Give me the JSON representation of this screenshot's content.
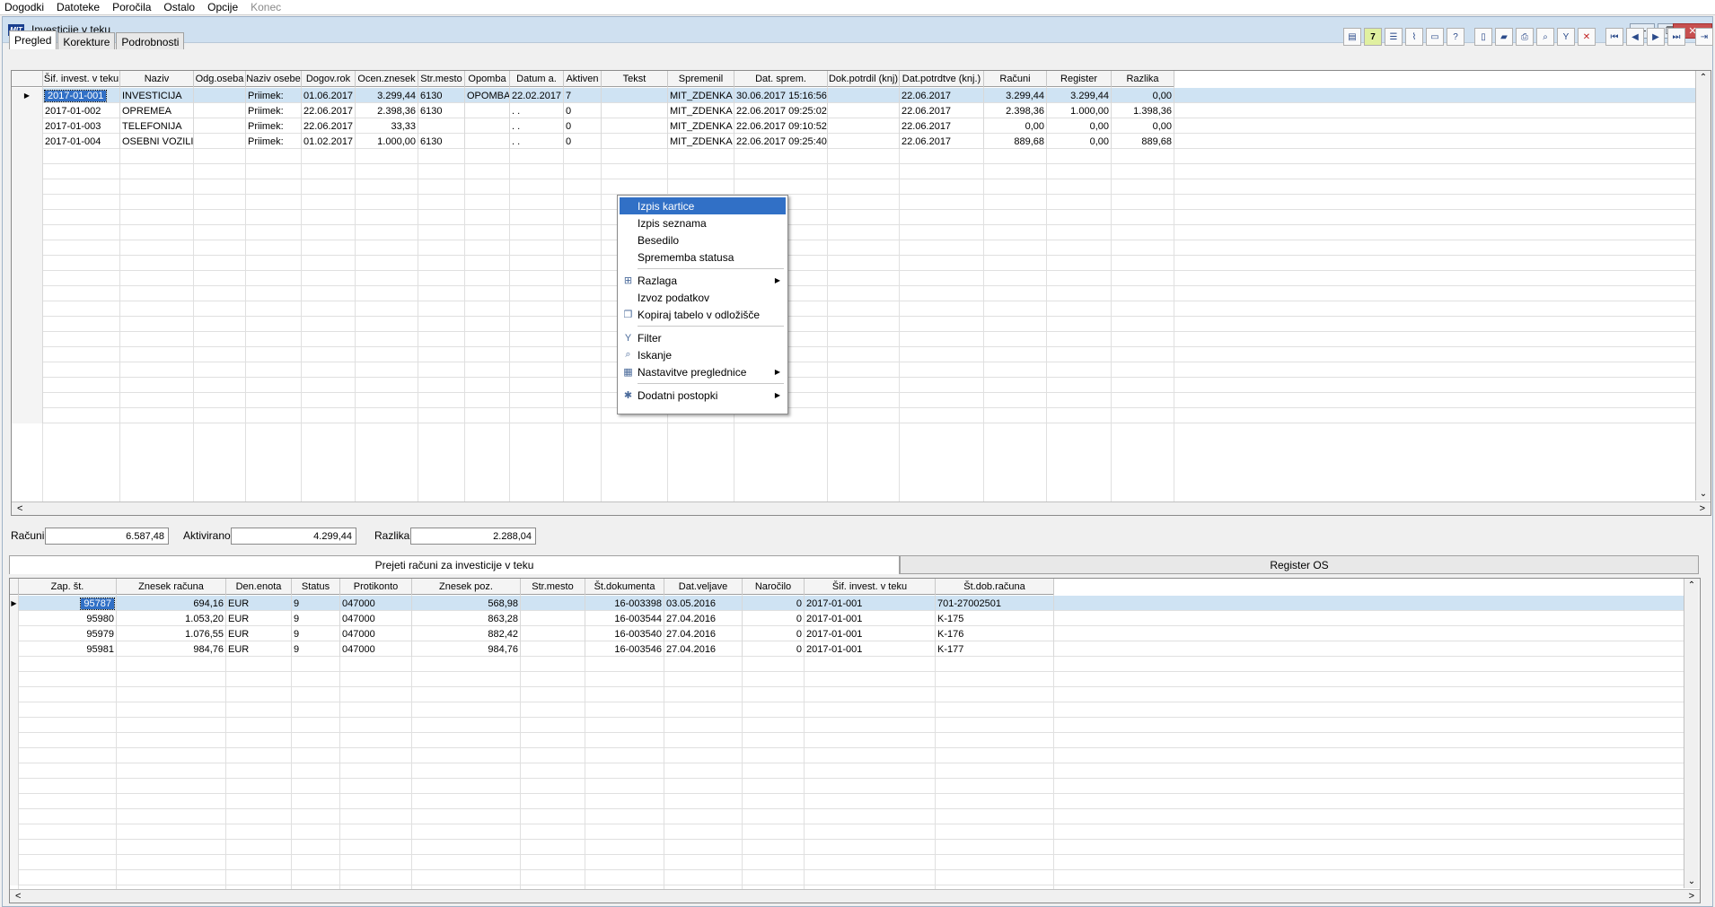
{
  "menubar": [
    "Dogodki",
    "Datoteke",
    "Poročila",
    "Ostalo",
    "Opcije",
    "Konec"
  ],
  "window": {
    "title": "Investicije v teku"
  },
  "tabs": [
    "Pregled",
    "Korekture",
    "Podrobnosti"
  ],
  "toolbar_icons": [
    "form-icon",
    "calendar-7-icon",
    "list-icon",
    "paperclip-icon",
    "monitor-icon",
    "help-icon",
    "new-document-icon",
    "open-folder-icon",
    "print-icon",
    "search-icon",
    "filter-icon",
    "delete-icon",
    "first-record-icon",
    "previous-record-icon",
    "next-record-icon",
    "last-record-icon",
    "exit-icon"
  ],
  "main_grid": {
    "columns": [
      "Šif. invest. v teku",
      "Naziv",
      "Odg.oseba",
      "Naziv osebe",
      "Dogov.rok",
      "Ocen.znesek",
      "Str.mesto",
      "Opomba",
      "Datum a.",
      "Aktiven",
      "Tekst",
      "Spremenil",
      "Dat. sprem.",
      "Dok.potrdil (knj)",
      "Dat.potrdtve (knj.)",
      "Računi",
      "Register",
      "Razlika"
    ],
    "rows": [
      [
        "2017-01-001",
        "INVESTICIJA",
        "",
        "Priimek:",
        "01.06.2017",
        "3.299,44",
        "6130",
        "OPOMBA",
        "22.02.2017",
        "7",
        "",
        "MIT_ZDENKA",
        "30.06.2017 15:16:56",
        "",
        "22.06.2017",
        "3.299,44",
        "3.299,44",
        "0,00"
      ],
      [
        "2017-01-002",
        "OPREMEA",
        "",
        "Priimek:",
        "22.06.2017",
        "2.398,36",
        "6130",
        "",
        ". .",
        "0",
        "",
        "MIT_ZDENKA",
        "22.06.2017 09:25:02",
        "",
        "22.06.2017",
        "2.398,36",
        "1.000,00",
        "1.398,36"
      ],
      [
        "2017-01-003",
        "TELEFONIJA",
        "",
        "Priimek:",
        "22.06.2017",
        "33,33",
        "",
        "",
        ". .",
        "0",
        "",
        "MIT_ZDENKA",
        "22.06.2017 09:10:52",
        "",
        "22.06.2017",
        "0,00",
        "0,00",
        "0,00"
      ],
      [
        "2017-01-004",
        "OSEBNI VOZILI",
        "",
        "Priimek:",
        "01.02.2017",
        "1.000,00",
        "6130",
        "",
        ". .",
        "0",
        "",
        "MIT_ZDENKA",
        "22.06.2017 09:25:40",
        "",
        "22.06.2017",
        "889,68",
        "0,00",
        "889,68"
      ]
    ]
  },
  "summary": {
    "racuni_label": "Računi",
    "racuni_value": "6.587,48",
    "aktivirano_label": "Aktivirano",
    "aktivirano_value": "4.299,44",
    "razlika_label": "Razlika",
    "razlika_value": "2.288,04"
  },
  "subtabs": [
    "Prejeti računi za investicije v teku",
    "Register OS"
  ],
  "bottom_grid": {
    "columns": [
      "Zap. št.",
      "Znesek računa",
      "Den.enota",
      "Status",
      "Protikonto",
      "Znesek poz.",
      "Str.mesto",
      "Št.dokumenta",
      "Dat.veljave",
      "Naročilo",
      "Šif. invest. v teku",
      "Št.dob.računa"
    ],
    "rows": [
      [
        "95787",
        "694,16",
        "EUR",
        "9",
        "047000",
        "568,98",
        "",
        "16-003398",
        "03.05.2016",
        "0",
        "2017-01-001",
        "701-27002501"
      ],
      [
        "95980",
        "1.053,20",
        "EUR",
        "9",
        "047000",
        "863,28",
        "",
        "16-003544",
        "27.04.2016",
        "0",
        "2017-01-001",
        "K-175"
      ],
      [
        "95979",
        "1.076,55",
        "EUR",
        "9",
        "047000",
        "882,42",
        "",
        "16-003540",
        "27.04.2016",
        "0",
        "2017-01-001",
        "K-176"
      ],
      [
        "95981",
        "984,76",
        "EUR",
        "9",
        "047000",
        "984,76",
        "",
        "16-003546",
        "27.04.2016",
        "0",
        "2017-01-001",
        "K-177"
      ]
    ]
  },
  "context_menu": {
    "items": [
      {
        "label": "Izpis kartice",
        "icon": "",
        "submenu": false,
        "highlighted": true
      },
      {
        "label": "Izpis seznama",
        "icon": "",
        "submenu": false
      },
      {
        "label": "Besedilo",
        "icon": "",
        "submenu": false
      },
      {
        "label": "Sprememba statusa",
        "icon": "",
        "submenu": false,
        "sep_after": true
      },
      {
        "label": "Razlaga",
        "icon": "tree-icon",
        "submenu": true
      },
      {
        "label": "Izvoz podatkov",
        "icon": "",
        "submenu": false
      },
      {
        "label": "Kopiraj tabelo v odložišče",
        "icon": "copy-icon",
        "submenu": false,
        "sep_after": true
      },
      {
        "label": "Filter",
        "icon": "filter-icon",
        "submenu": false
      },
      {
        "label": "Iskanje",
        "icon": "search-icon",
        "submenu": false
      },
      {
        "label": "Nastavitve preglednice",
        "icon": "settings-icon",
        "submenu": true,
        "sep_after": true
      },
      {
        "label": "Dodatni postopki",
        "icon": "gear-icon",
        "submenu": true
      }
    ]
  },
  "colors": {
    "selection": "#cfe3f3",
    "highlight": "#3170c6",
    "title_bar": "#cfe0f0"
  }
}
